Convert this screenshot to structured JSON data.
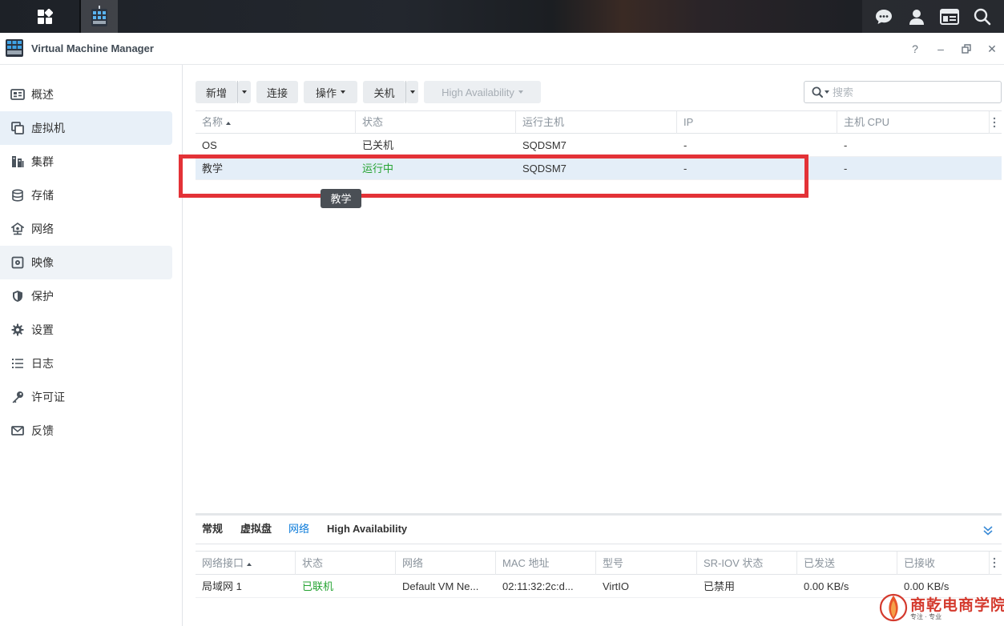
{
  "window": {
    "title": "Virtual Machine Manager",
    "help": "?",
    "minimize": "–",
    "close": "✕"
  },
  "sidebar": {
    "items": [
      {
        "label": "概述",
        "icon": "overview-icon"
      },
      {
        "label": "虚拟机",
        "icon": "vm-icon"
      },
      {
        "label": "集群",
        "icon": "cluster-icon"
      },
      {
        "label": "存储",
        "icon": "storage-icon"
      },
      {
        "label": "网络",
        "icon": "network-icon"
      },
      {
        "label": "映像",
        "icon": "image-icon"
      },
      {
        "label": "保护",
        "icon": "shield-icon"
      },
      {
        "label": "设置",
        "icon": "gear-icon"
      },
      {
        "label": "日志",
        "icon": "list-icon"
      },
      {
        "label": "许可证",
        "icon": "key-icon"
      },
      {
        "label": "反馈",
        "icon": "mail-icon"
      }
    ]
  },
  "toolbar": {
    "create": "新增",
    "connect": "连接",
    "action": "操作",
    "shutdown": "关机",
    "high_availability": "High Availability"
  },
  "search": {
    "placeholder": "搜索"
  },
  "grid": {
    "columns": [
      "名称",
      "状态",
      "运行主机",
      "IP",
      "主机 CPU"
    ],
    "rows": [
      {
        "name": "OS",
        "status": "已关机",
        "host": "SQDSM7",
        "ip": "-",
        "cpu": "-"
      },
      {
        "name": "教学",
        "status": "运行中",
        "host": "SQDSM7",
        "ip": "-",
        "cpu": "-"
      }
    ],
    "tooltip": "教学"
  },
  "bottom": {
    "tabs": [
      "常规",
      "虚拟盘",
      "网络",
      "High Availability"
    ],
    "columns": [
      "网络接口",
      "状态",
      "网络",
      "MAC 地址",
      "型号",
      "SR-IOV 状态",
      "已发送",
      "已接收"
    ],
    "row": {
      "iface": "局域网 1",
      "status": "已联机",
      "network": "Default VM Ne...",
      "mac": "02:11:32:2c:d...",
      "model": "VirtIO",
      "sriov": "已禁用",
      "sent": "0.00 KB/s",
      "received": "0.00 KB/s"
    }
  },
  "watermark": {
    "text": "商乾电商学院",
    "sub": "专注 · 专业"
  },
  "colors": {
    "accent": "#0a7ad9",
    "running": "#24a331",
    "highlight_box": "#e33237"
  }
}
